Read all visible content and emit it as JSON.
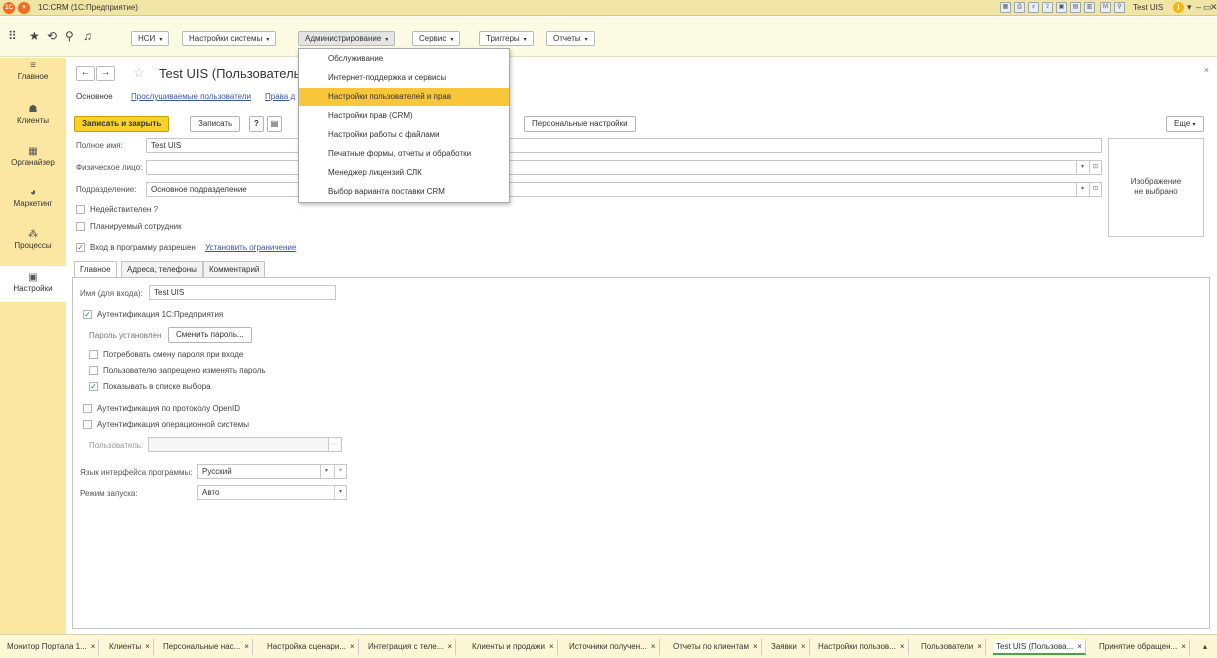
{
  "window": {
    "logo": "1C",
    "title": "1С:CRM  (1С:Предприятие)",
    "user": "Test UIS",
    "info": "i"
  },
  "toolbar": {
    "menus": [
      {
        "label": "НСИ"
      },
      {
        "label": "Настройки системы"
      },
      {
        "label": "Администрирование"
      },
      {
        "label": "Сервис"
      },
      {
        "label": "Триггеры"
      },
      {
        "label": "Отчеты"
      }
    ]
  },
  "sidebar": {
    "items": [
      {
        "label": "Главное"
      },
      {
        "label": "Клиенты"
      },
      {
        "label": "Органайзер"
      },
      {
        "label": "Маркетинг"
      },
      {
        "label": "Процессы"
      },
      {
        "label": "Настройки"
      }
    ]
  },
  "dropdown": {
    "items": [
      {
        "label": "Обслуживание"
      },
      {
        "label": "Интернет-поддержка и сервисы"
      },
      {
        "label": "Настройки пользователей и прав"
      },
      {
        "label": "Настройки прав (CRM)"
      },
      {
        "label": "Настройки работы с файлами"
      },
      {
        "label": "Печатные формы, отчеты и обработки"
      },
      {
        "label": "Менеджер лицензий СЛК"
      },
      {
        "label": "Выбор варианта поставки CRM"
      }
    ]
  },
  "form": {
    "title": "Test UIS (Пользователь)",
    "tabs": [
      "Основное",
      "Прослушиваемые пользователи",
      "Права д"
    ],
    "buttons": {
      "save_close": "Записать и закрыть",
      "save": "Записать",
      "help": "?",
      "personal": "Персональные настройки",
      "more": "Еще"
    },
    "full_name_label": "Полное имя:",
    "full_name": "Test UIS",
    "person_label": "Физическое лицо:",
    "person": "",
    "division_label": "Подразделение:",
    "division": "Основное подразделение",
    "invalid_label": "Недействителен",
    "invalid_help": "?",
    "planned_label": "Планируемый сотрудник",
    "login_allowed_label": "Вход в программу разрешен",
    "set_restriction": "Установить ограничение",
    "image_text_1": "Изображение",
    "image_text_2": "не выбрано"
  },
  "inner_tabs": [
    "Главное",
    "Адреса, телефоны",
    "Комментарий"
  ],
  "main_tab": {
    "login_name_label": "Имя (для входа):",
    "login_name": "Test UIS",
    "auth_1c_label": "Аутентификация 1С:Предприятия",
    "password_set": "Пароль установлен",
    "change_password": "Сменить пароль...",
    "require_change": "Потребовать смену пароля при входе",
    "forbid_change": "Пользователю запрещено изменять пароль",
    "show_in_list": "Показывать в списке выбора",
    "auth_openid": "Аутентификация по протоколу OpenID",
    "auth_os": "Аутентификация операционной системы",
    "os_user_label": "Пользователь:",
    "os_user": "",
    "language_label": "Язык интерфейса программы:",
    "language": "Русский",
    "mode_label": "Режим запуска:",
    "mode": "Авто"
  },
  "bottom_tabs": [
    {
      "label": "Монитор Портала 1..."
    },
    {
      "label": "Клиенты"
    },
    {
      "label": "Персональные нас..."
    },
    {
      "label": "Настройка сценари..."
    },
    {
      "label": "Интеграция с теле..."
    },
    {
      "label": "Клиенты и продажи"
    },
    {
      "label": "Источники получен..."
    },
    {
      "label": "Отчеты по клиентам"
    },
    {
      "label": "Заявки"
    },
    {
      "label": "Настройки пользов..."
    },
    {
      "label": "Пользователи"
    },
    {
      "label": "Test UIS (Пользова..."
    },
    {
      "label": "Принятие обращен..."
    }
  ]
}
